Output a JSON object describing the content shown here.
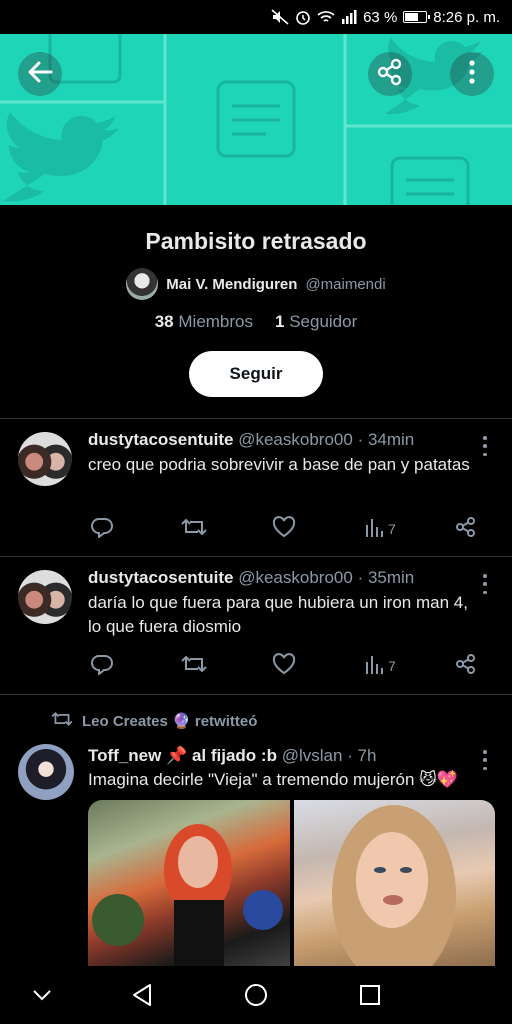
{
  "status": {
    "battery": "63 %",
    "battery_level": 0.63,
    "time": "8:26 p. m."
  },
  "list": {
    "title": "Pambisito retrasado",
    "owner_name": "Mai V. Mendiguren",
    "owner_handle": "@maimendi",
    "members_count": "38",
    "members_label": "Miembros",
    "followers_count": "1",
    "followers_label": "Seguidor",
    "follow_label": "Seguir"
  },
  "tweets": [
    {
      "name": "dustytacosentuite",
      "handle": "@keaskobro00",
      "time": "· 34min",
      "text": "creo que podria sobrevivir a base de pan y patatas",
      "views": "7"
    },
    {
      "name": "dustytacosentuite",
      "handle": "@keaskobro00",
      "time": "· 35min",
      "text": "daría lo que fuera para que hubiera un iron man 4, lo que fuera diosmio",
      "views": "7"
    },
    {
      "retweeted_by": "Leo Creates 🔮 retwitteó",
      "name": "Toff_new 📌 al fijado :b",
      "handle": "@lvslan",
      "time": "· 7h",
      "text": "Imagina decirle \"Vieja\" a tremendo mujerón 😼💖"
    }
  ],
  "icons": [
    "back-arrow-icon",
    "share-icon",
    "more-vertical-icon",
    "reply-icon",
    "retweet-icon",
    "like-icon",
    "views-icon",
    "share-icon",
    "nav-back-icon",
    "nav-home-icon",
    "nav-recents-icon",
    "nav-collapse-icon"
  ],
  "colors": {
    "banner": "#1fd5b8",
    "background": "#000000",
    "muted": "#8b98a5"
  }
}
